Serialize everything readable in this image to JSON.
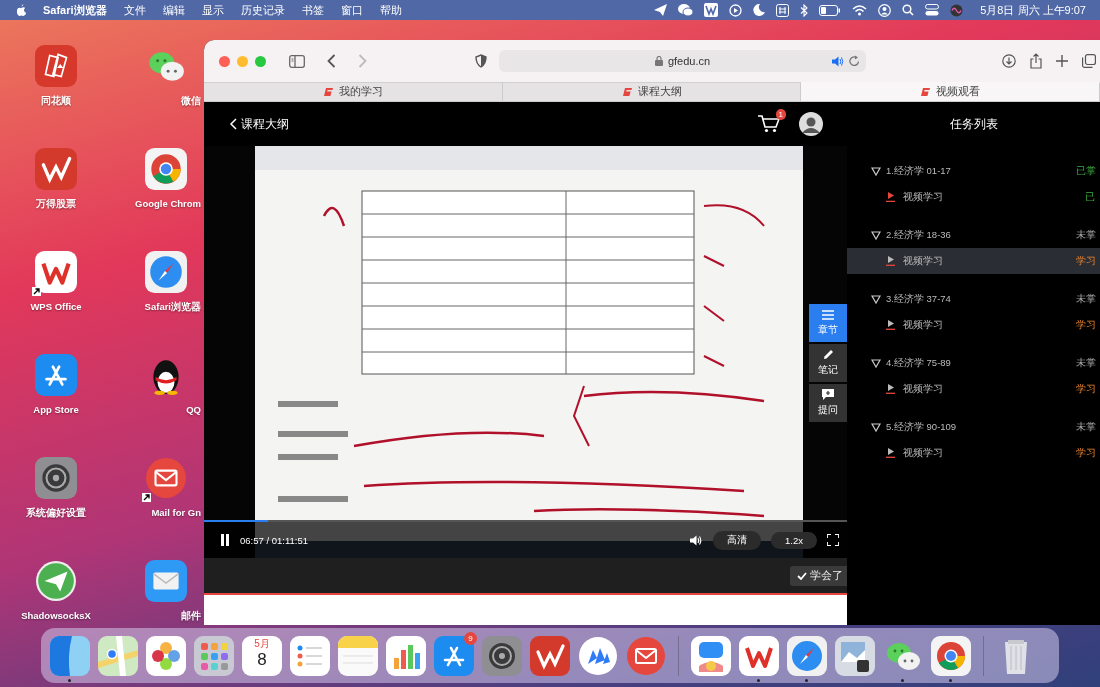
{
  "menubar": {
    "app": "Safari浏览器",
    "menus": [
      "文件",
      "编辑",
      "显示",
      "历史记录",
      "书签",
      "窗口",
      "帮助"
    ],
    "clock": "5月8日 周六 上午9:07"
  },
  "desktop_icons": [
    {
      "label": "同花顺",
      "kind": "cards",
      "alias": false
    },
    {
      "label": "微信",
      "kind": "wechat",
      "alias": false
    },
    {
      "label": "万得股票",
      "kind": "wind",
      "alias": false
    },
    {
      "label": "Google Chrom",
      "kind": "chrome",
      "alias": false
    },
    {
      "label": "WPS Office",
      "kind": "wps",
      "alias": true
    },
    {
      "label": "Safari浏览器",
      "kind": "safari",
      "alias": false
    },
    {
      "label": "App Store",
      "kind": "appstore",
      "alias": false
    },
    {
      "label": "QQ",
      "kind": "qq",
      "alias": false
    },
    {
      "label": "系统偏好设置",
      "kind": "settings",
      "alias": false
    },
    {
      "label": "Mail for Gn",
      "kind": "redmail",
      "alias": true
    },
    {
      "label": "ShadowsocksX",
      "kind": "plane",
      "alias": false
    },
    {
      "label": "邮件",
      "kind": "mail",
      "alias": false
    }
  ],
  "browser": {
    "address": "gfedu.cn",
    "tabs": [
      {
        "title": "我的学习",
        "selected": false
      },
      {
        "title": "课程大纲",
        "selected": false
      },
      {
        "title": "视频观看",
        "selected": true
      }
    ]
  },
  "page": {
    "back": "课程大纲",
    "cart_count": "1",
    "player": {
      "playing": true,
      "time": "06:57 / 01:11:51",
      "quality": "高清",
      "speed": "1.2x",
      "level": 0.1
    },
    "side_buttons": [
      {
        "label": "章节",
        "kind": "list",
        "selected": true
      },
      {
        "label": "笔记",
        "kind": "pen",
        "selected": false
      },
      {
        "label": "提问",
        "kind": "chat",
        "selected": false
      }
    ],
    "learned_button": "学会了"
  },
  "tasks": {
    "title": "任务列表",
    "chapters": [
      {
        "title": "1.经济学 01-17",
        "status": "已掌",
        "mastered": true,
        "children": [
          {
            "title": "视频学习",
            "status": "已",
            "kind": "done",
            "selected": false
          }
        ]
      },
      {
        "title": "2.经济学 18-36",
        "status": "未掌",
        "mastered": false,
        "children": [
          {
            "title": "视频学习",
            "status": "学习",
            "kind": "learning",
            "selected": true
          }
        ]
      },
      {
        "title": "3.经济学 37-74",
        "status": "未掌",
        "mastered": false,
        "children": [
          {
            "title": "视频学习",
            "status": "学习",
            "kind": "learning",
            "selected": false
          }
        ]
      },
      {
        "title": "4.经济学 75-89",
        "status": "未掌",
        "mastered": false,
        "children": [
          {
            "title": "视频学习",
            "status": "学习",
            "kind": "learning",
            "selected": false
          }
        ]
      },
      {
        "title": "5.经济学 90-109",
        "status": "未掌",
        "mastered": false,
        "children": [
          {
            "title": "视频学习",
            "status": "学习",
            "kind": "learning",
            "selected": false
          }
        ]
      }
    ]
  },
  "dock": [
    {
      "kind": "finder",
      "running": true
    },
    {
      "kind": "maps",
      "running": false
    },
    {
      "kind": "photos",
      "running": false
    },
    {
      "kind": "launchpad",
      "running": false
    },
    {
      "kind": "calendar",
      "running": false,
      "month": "5月",
      "day": "8"
    },
    {
      "kind": "reminders",
      "running": false
    },
    {
      "kind": "notes",
      "running": false
    },
    {
      "kind": "numbers",
      "running": false
    },
    {
      "kind": "appstore",
      "running": false,
      "badge": "9"
    },
    {
      "kind": "settings",
      "running": false
    },
    {
      "kind": "wind",
      "running": false
    },
    {
      "kind": "drops",
      "running": false
    },
    {
      "kind": "redmail",
      "running": false
    },
    {
      "kind": "separator"
    },
    {
      "kind": "translate",
      "running": false
    },
    {
      "kind": "wps",
      "running": true
    },
    {
      "kind": "safari",
      "running": true
    },
    {
      "kind": "preview",
      "running": false
    },
    {
      "kind": "wechat",
      "running": true
    },
    {
      "kind": "chrome",
      "running": true
    },
    {
      "kind": "separator"
    },
    {
      "kind": "trash",
      "running": false
    }
  ]
}
